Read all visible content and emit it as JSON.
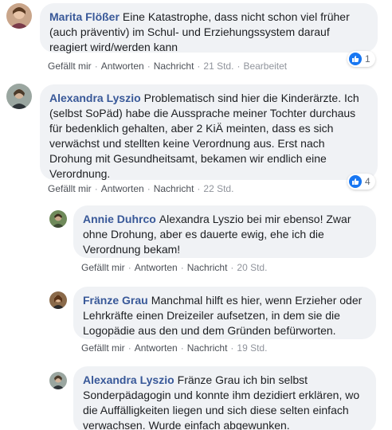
{
  "comments": [
    {
      "author": "Marita Flößer",
      "text": "Eine Katastrophe, dass nicht schon viel früher (auch präventiv) im Schul- und Erziehungssystem darauf reagiert wird/werden kann",
      "actions": {
        "like": "Gefällt mir",
        "reply": "Antworten",
        "message": "Nachricht",
        "time": "21 Std.",
        "edited": "Bearbeitet"
      },
      "reaction_count": "1"
    },
    {
      "author": "Alexandra Lyszio",
      "text": "Problematisch sind hier die Kinderärzte. Ich (selbst SoPäd) habe die Aussprache meiner Tochter durchaus für bedenklich gehalten, aber 2 KiÄ meinten, dass es sich verwächst und stellten keine Verordnung aus. Erst nach Drohung mit Gesundheitsamt, bekamen wir endlich eine Verordnung.",
      "actions": {
        "like": "Gefällt mir",
        "reply": "Antworten",
        "message": "Nachricht",
        "time": "22 Std."
      },
      "reaction_count": "4"
    },
    {
      "author": "Annie Duhrco",
      "text": "Alexandra Lyszio bei mir ebenso! Zwar ohne Drohung, aber es dauerte ewig, ehe ich die Verordnung bekam!",
      "actions": {
        "like": "Gefällt mir",
        "reply": "Antworten",
        "message": "Nachricht",
        "time": "20 Std."
      }
    },
    {
      "author": "Fränze Grau",
      "text": "Manchmal hilft es hier, wenn Erzieher oder Lehrkräfte einen Dreizeiler aufsetzen, in dem sie die Logopädie aus den und dem Gründen befürworten.",
      "actions": {
        "like": "Gefällt mir",
        "reply": "Antworten",
        "message": "Nachricht",
        "time": "19 Std."
      }
    },
    {
      "author": "Alexandra Lyszio",
      "text": "Fränze Grau ich bin selbst Sonderpädagogin und konnte ihm dezidiert erklären, wo die Auffälligkeiten liegen und sich diese selten einfach verwachsen. Wurde einfach abgewunken."
    }
  ],
  "colors": {
    "author": "#385898",
    "bubble": "#f0f2f5",
    "like": "#1877f2"
  }
}
